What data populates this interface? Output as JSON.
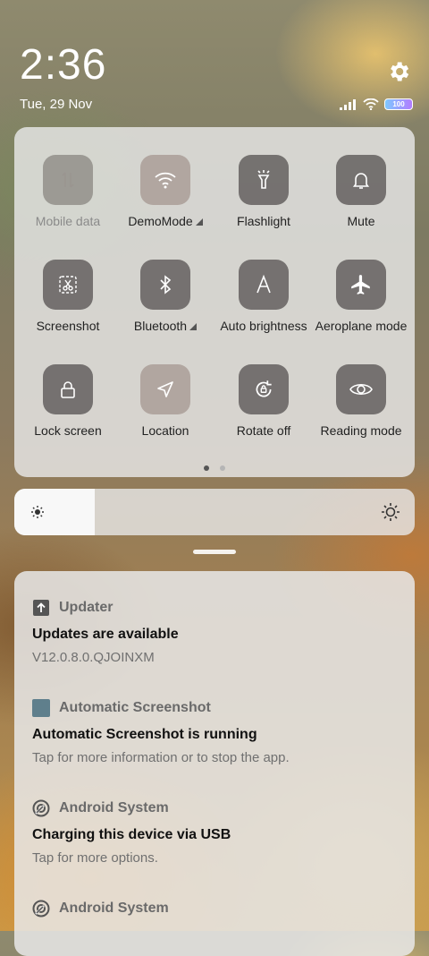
{
  "status_bar": {
    "time": "2:36",
    "date": "Tue, 29 Nov",
    "battery": "100"
  },
  "quick_settings": {
    "tiles": [
      {
        "label": "Mobile data",
        "icon": "mobile-data-icon"
      },
      {
        "label": "DemoMode",
        "icon": "wifi-icon"
      },
      {
        "label": "Flashlight",
        "icon": "flashlight-icon"
      },
      {
        "label": "Mute",
        "icon": "bell-icon"
      },
      {
        "label": "Screenshot",
        "icon": "scissors-icon"
      },
      {
        "label": "Bluetooth",
        "icon": "bluetooth-icon"
      },
      {
        "label": "Auto brightness",
        "icon": "auto-brightness-icon"
      },
      {
        "label": "Aeroplane mode",
        "icon": "airplane-icon"
      },
      {
        "label": "Lock screen",
        "icon": "lock-icon"
      },
      {
        "label": "Location",
        "icon": "location-icon"
      },
      {
        "label": "Rotate off",
        "icon": "rotate-icon"
      },
      {
        "label": "Reading mode",
        "icon": "eye-icon"
      }
    ],
    "page_count": 2,
    "current_page": 1
  },
  "brightness": {
    "level": 0.2
  },
  "notifications": [
    {
      "app": "Updater",
      "title": "Updates are available",
      "body": "V12.0.8.0.QJOINXM",
      "icon": "updater-icon"
    },
    {
      "app": "Automatic Screenshot",
      "title": "Automatic Screenshot is running",
      "body": "Tap for more information or to stop the app.",
      "icon": "app-square-icon"
    },
    {
      "app": "Android System",
      "title": "Charging this device via USB",
      "body": "Tap for more options.",
      "icon": "android-system-icon"
    },
    {
      "app": "Android System",
      "title": "",
      "body": "",
      "icon": "android-system-icon"
    }
  ],
  "colors": {
    "tile_active": "#aa9e98",
    "tile_default": "#5f5c5a",
    "panel": "#e8e8e8"
  }
}
